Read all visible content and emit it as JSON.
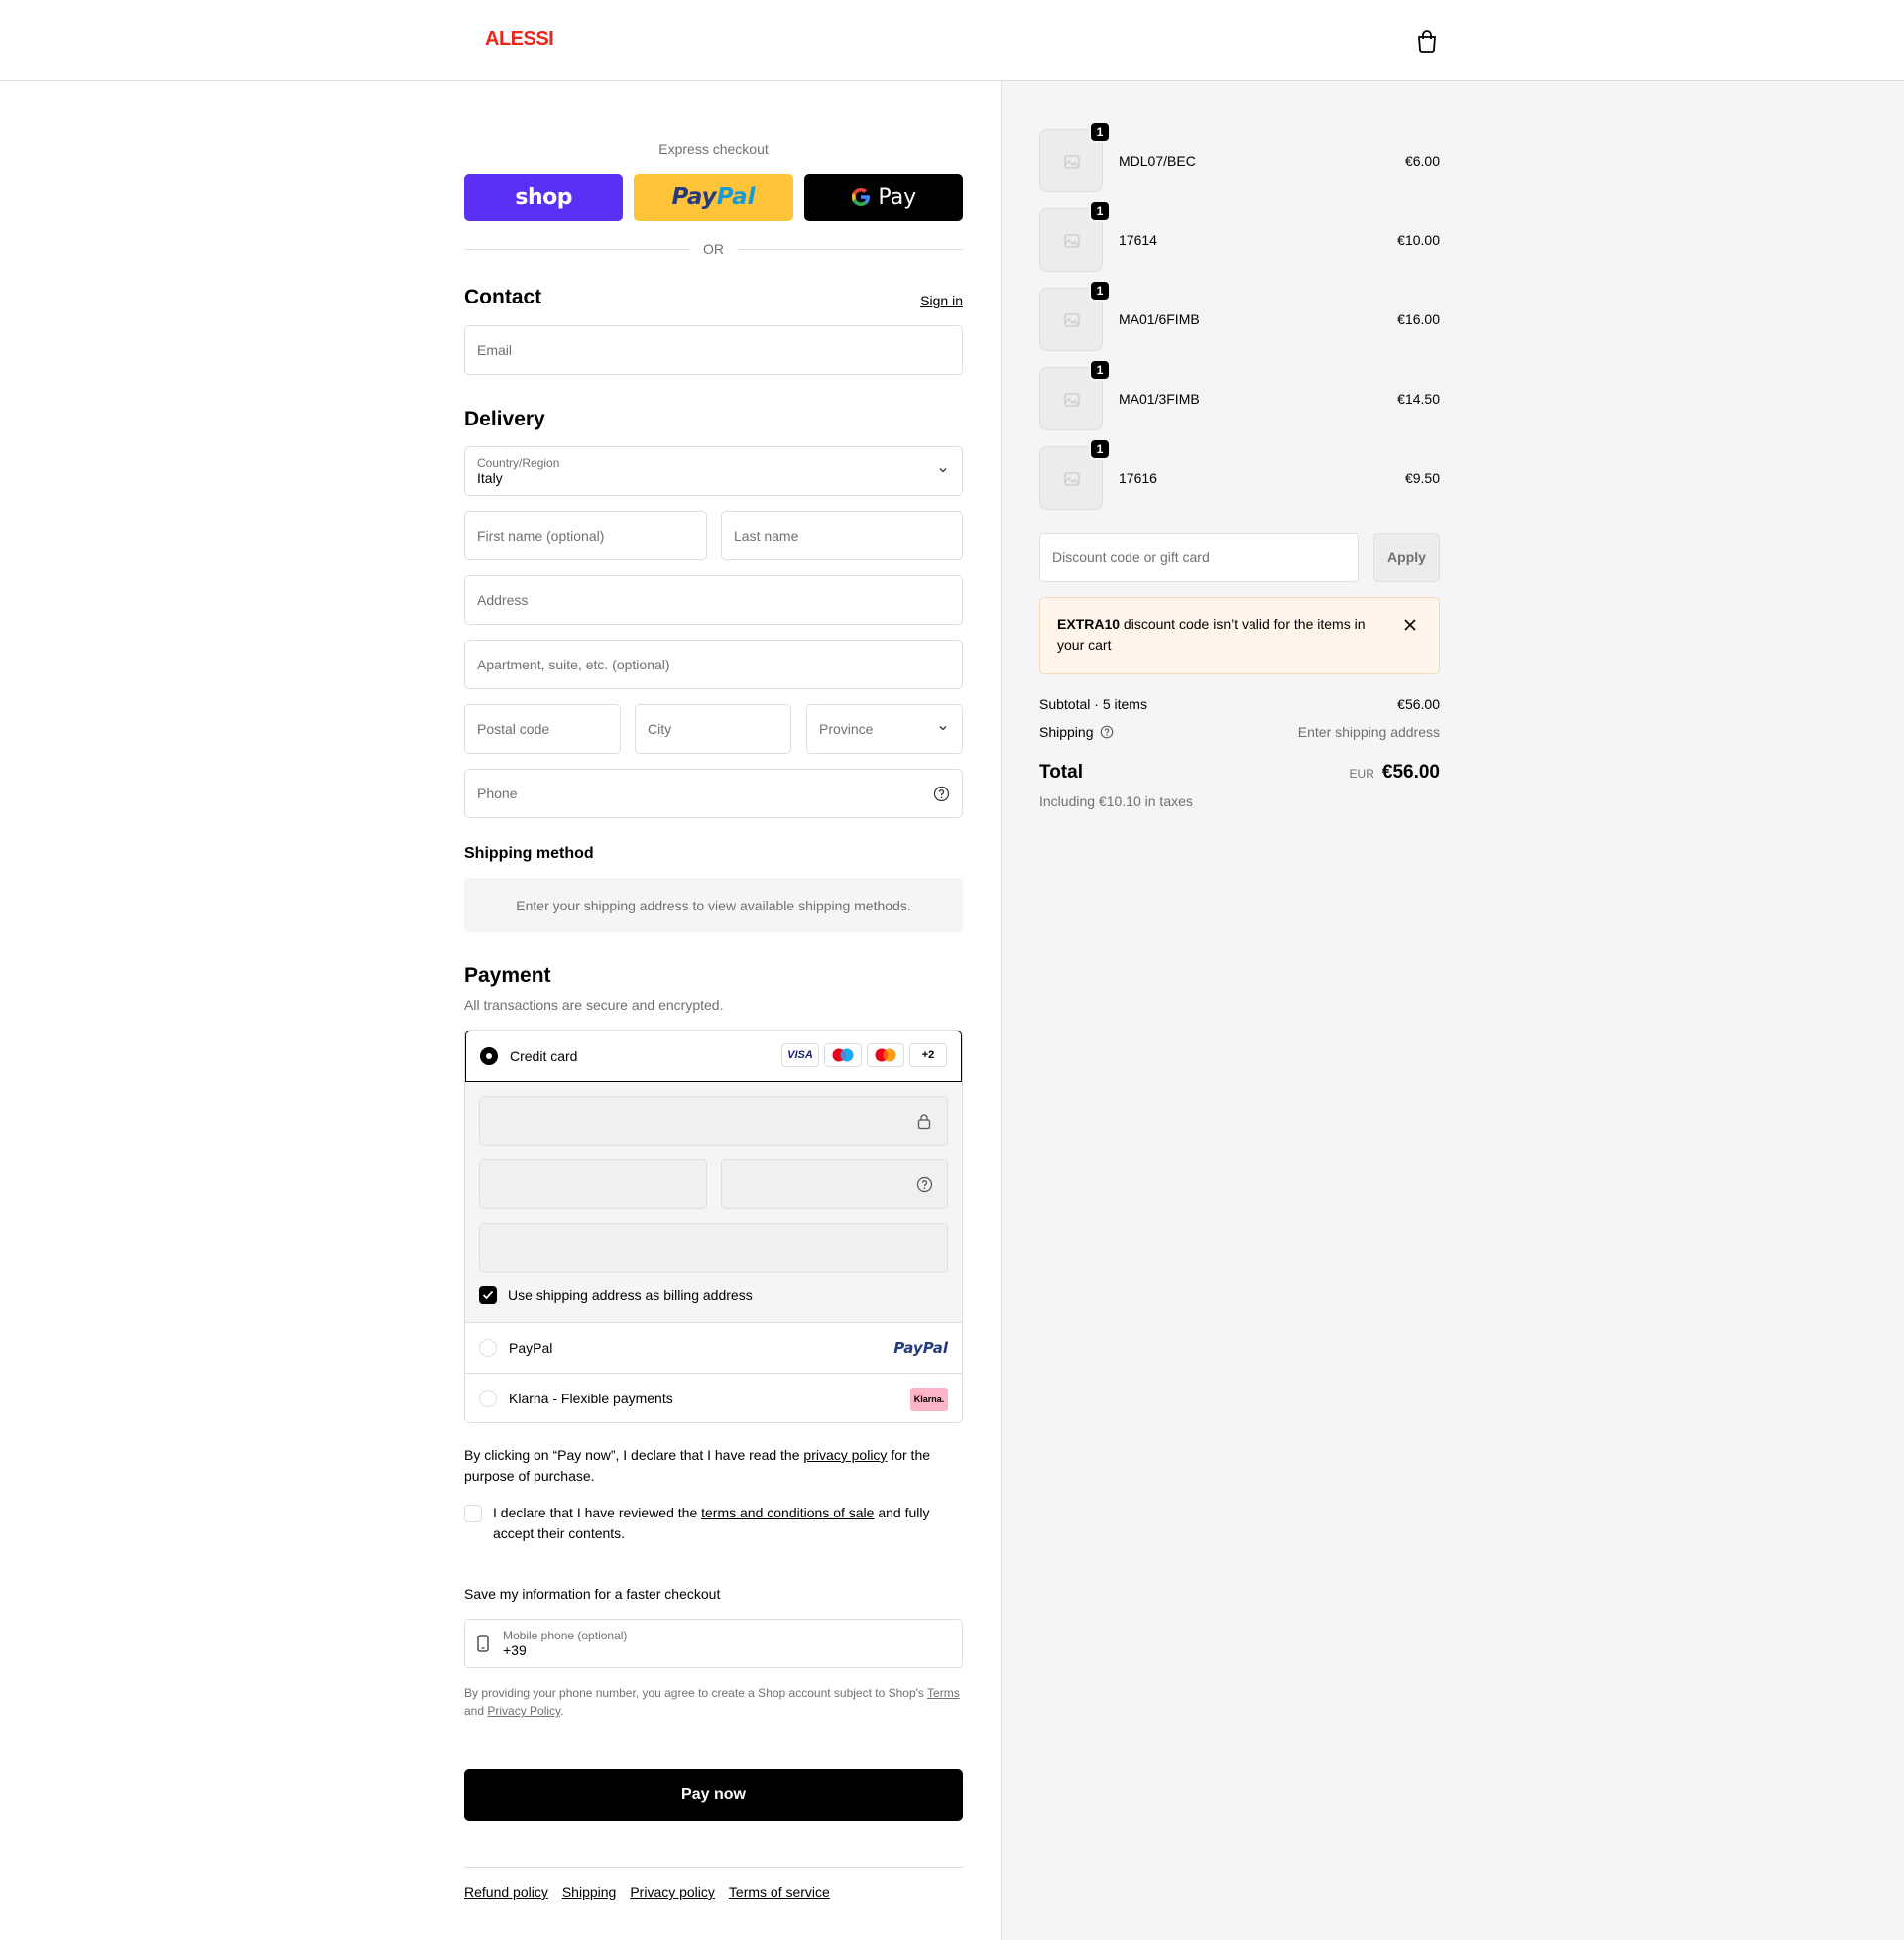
{
  "header": {
    "logo": "ALESSI"
  },
  "express": {
    "title": "Express checkout",
    "shop_label": "shop",
    "paypal_part1": "Pay",
    "paypal_part2": "Pal",
    "gpay_label": "Pay",
    "or": "OR"
  },
  "contact": {
    "title": "Contact",
    "signin": "Sign in",
    "email_placeholder": "Email"
  },
  "delivery": {
    "title": "Delivery",
    "country_label": "Country/Region",
    "country_value": "Italy",
    "first_name": "First name (optional)",
    "last_name": "Last name",
    "address": "Address",
    "apartment": "Apartment, suite, etc. (optional)",
    "postal": "Postal code",
    "city": "City",
    "province": "Province",
    "phone": "Phone"
  },
  "shipping_method": {
    "title": "Shipping method",
    "message": "Enter your shipping address to view available shipping methods."
  },
  "payment": {
    "title": "Payment",
    "subtitle": "All transactions are secure and encrypted.",
    "credit_card": "Credit card",
    "card_logos": [
      "VISA",
      "+2"
    ],
    "billing_same": "Use shipping address as billing address",
    "paypal": "PayPal",
    "paypal_logo": "PayPal",
    "klarna": "Klarna - Flexible payments",
    "klarna_logo": "Klarna."
  },
  "legal": {
    "declare1_a": "By clicking on “Pay now”, I declare that I have read the ",
    "declare1_link": "privacy policy",
    "declare1_b": " for the purpose of purchase.",
    "declare2_a": "I declare that I have reviewed the ",
    "declare2_link": "terms and conditions of sale",
    "declare2_b": " and fully accept their contents."
  },
  "save_info": {
    "title": "Save my information for a faster checkout",
    "mobile_label": "Mobile phone (optional)",
    "mobile_value": "+39",
    "terms_a": "By providing your phone number, you agree to create a Shop account subject to Shop's ",
    "terms_link": "Terms",
    "terms_b": " and ",
    "privacy_link": "Privacy Policy",
    "terms_c": "."
  },
  "pay_now": "Pay now",
  "footer": {
    "links": [
      "Refund policy",
      "Shipping",
      "Privacy policy",
      "Terms of service"
    ]
  },
  "cart": {
    "items": [
      {
        "qty": "1",
        "name": "MDL07/BEC",
        "price": "€6.00"
      },
      {
        "qty": "1",
        "name": "17614",
        "price": "€10.00"
      },
      {
        "qty": "1",
        "name": "MA01/6FIMB",
        "price": "€16.00"
      },
      {
        "qty": "1",
        "name": "MA01/3FIMB",
        "price": "€14.50"
      },
      {
        "qty": "1",
        "name": "17616",
        "price": "€9.50"
      }
    ],
    "discount_placeholder": "Discount code or gift card",
    "apply": "Apply",
    "warning_code": "EXTRA10",
    "warning_text": " discount code isn’t valid for the items in your cart",
    "subtotal_label": "Subtotal · 5 items",
    "subtotal_value": "€56.00",
    "shipping_label": "Shipping",
    "shipping_value": "Enter shipping address",
    "total_label": "Total",
    "total_currency": "EUR",
    "total_value": "€56.00",
    "taxes": "Including €10.10 in taxes"
  }
}
